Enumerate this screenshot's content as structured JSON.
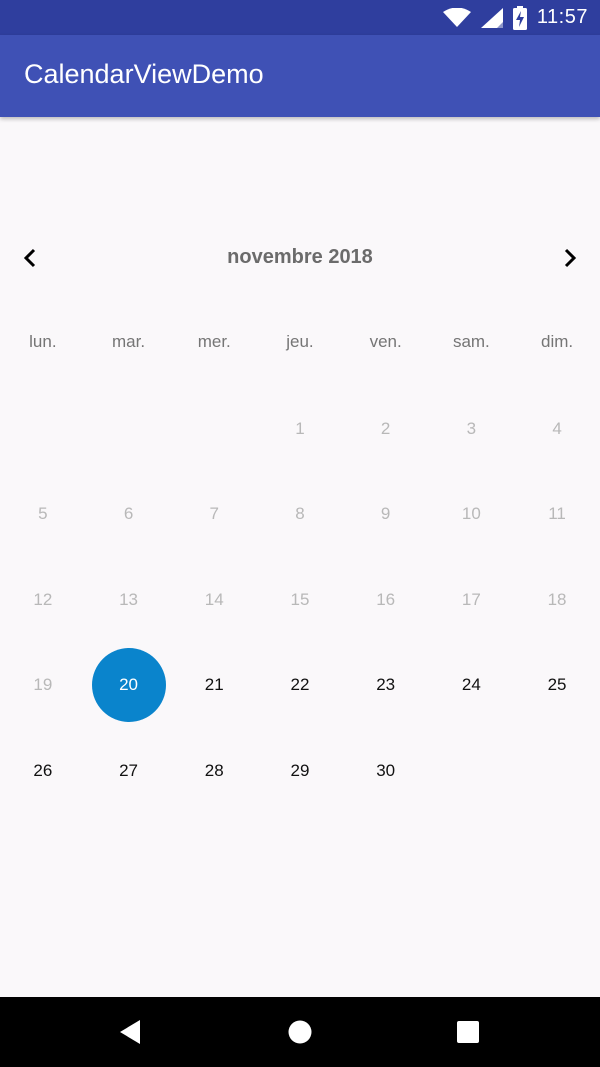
{
  "status_bar": {
    "time": "11:57",
    "icons": [
      "wifi-icon",
      "signal-icon",
      "battery-charging-icon"
    ],
    "color": "#2f3e9e"
  },
  "app_bar": {
    "title": "CalendarViewDemo",
    "color": "#3f51b5"
  },
  "calendar": {
    "month_label": "novembre 2018",
    "prev_icon": "chevron-left-icon",
    "next_icon": "chevron-right-icon",
    "weekdays": [
      "lun.",
      "mar.",
      "mer.",
      "jeu.",
      "ven.",
      "sam.",
      "dim."
    ],
    "weeks": [
      [
        {
          "label": "",
          "state": "empty"
        },
        {
          "label": "",
          "state": "empty"
        },
        {
          "label": "",
          "state": "empty"
        },
        {
          "label": "1",
          "state": "disabled"
        },
        {
          "label": "2",
          "state": "disabled"
        },
        {
          "label": "3",
          "state": "disabled"
        },
        {
          "label": "4",
          "state": "disabled"
        }
      ],
      [
        {
          "label": "5",
          "state": "disabled"
        },
        {
          "label": "6",
          "state": "disabled"
        },
        {
          "label": "7",
          "state": "disabled"
        },
        {
          "label": "8",
          "state": "disabled"
        },
        {
          "label": "9",
          "state": "disabled"
        },
        {
          "label": "10",
          "state": "disabled"
        },
        {
          "label": "11",
          "state": "disabled"
        }
      ],
      [
        {
          "label": "12",
          "state": "disabled"
        },
        {
          "label": "13",
          "state": "disabled"
        },
        {
          "label": "14",
          "state": "disabled"
        },
        {
          "label": "15",
          "state": "disabled"
        },
        {
          "label": "16",
          "state": "disabled"
        },
        {
          "label": "17",
          "state": "disabled"
        },
        {
          "label": "18",
          "state": "disabled"
        }
      ],
      [
        {
          "label": "19",
          "state": "disabled"
        },
        {
          "label": "20",
          "state": "selected"
        },
        {
          "label": "21",
          "state": "enabled"
        },
        {
          "label": "22",
          "state": "enabled"
        },
        {
          "label": "23",
          "state": "enabled"
        },
        {
          "label": "24",
          "state": "enabled"
        },
        {
          "label": "25",
          "state": "enabled"
        }
      ],
      [
        {
          "label": "26",
          "state": "enabled"
        },
        {
          "label": "27",
          "state": "enabled"
        },
        {
          "label": "28",
          "state": "enabled"
        },
        {
          "label": "29",
          "state": "enabled"
        },
        {
          "label": "30",
          "state": "enabled"
        },
        {
          "label": "",
          "state": "empty"
        },
        {
          "label": "",
          "state": "empty"
        }
      ]
    ],
    "selected_color": "#0a84cc",
    "disabled_color": "#b8b8b8"
  },
  "nav_bar": {
    "buttons": [
      "back-icon",
      "home-icon",
      "recents-icon"
    ]
  }
}
